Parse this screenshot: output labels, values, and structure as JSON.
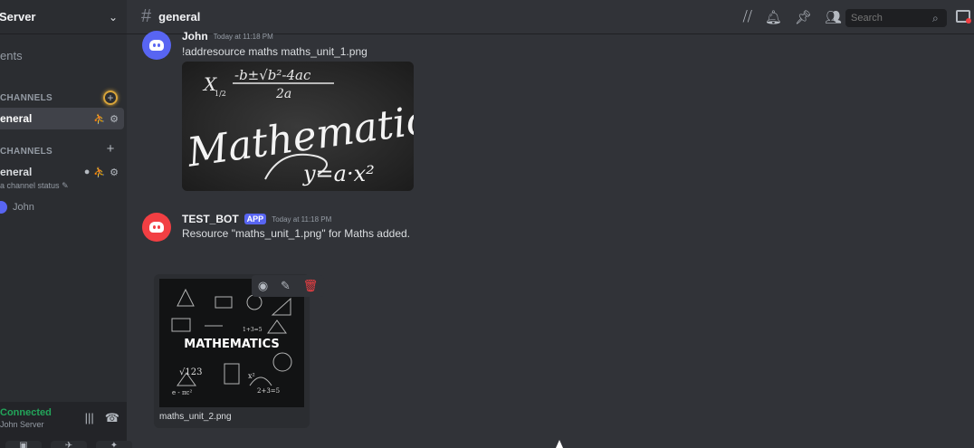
{
  "server": {
    "name": "Server"
  },
  "sidebar": {
    "events": "ents",
    "categories": [
      {
        "label": "CHANNELS"
      },
      {
        "label": "CHANNELS"
      }
    ],
    "text_channel": {
      "label": "eneral"
    },
    "voice_channel": {
      "label": "eneral",
      "status": "a channel status"
    },
    "voice_user": {
      "name": "John"
    }
  },
  "voice_panel": {
    "status": "Connected",
    "server": "John Server"
  },
  "topbar": {
    "channel_name": "general",
    "search_placeholder": "Search"
  },
  "messages": [
    {
      "author": "John",
      "timestamp": "Today at 11:18 PM",
      "text": "!addresource maths maths_unit_1.png",
      "image": {
        "formula_top": "-b±√b²-4ac",
        "formula_den": "2a",
        "x_label": "X",
        "x_sub": "1/2",
        "word": "Mathematics",
        "eq": "y=a·x²"
      }
    },
    {
      "author": "TEST_BOT",
      "badge": "APP",
      "timestamp": "Today at 11:18 PM",
      "text": "Resource \"maths_unit_1.png\" for Maths added."
    }
  ],
  "attachment": {
    "filename": "maths_unit_2.png",
    "image_word": "MATHEMATICS",
    "image_bits": [
      "√123",
      "e - πc²",
      "1+3=5",
      "x²",
      "2+3=5"
    ]
  },
  "colors": {
    "background": "#313338",
    "sidebar": "#2b2d31",
    "accent": "#5865f2",
    "bot_avatar": "#f23f43",
    "connected": "#23a55a"
  }
}
